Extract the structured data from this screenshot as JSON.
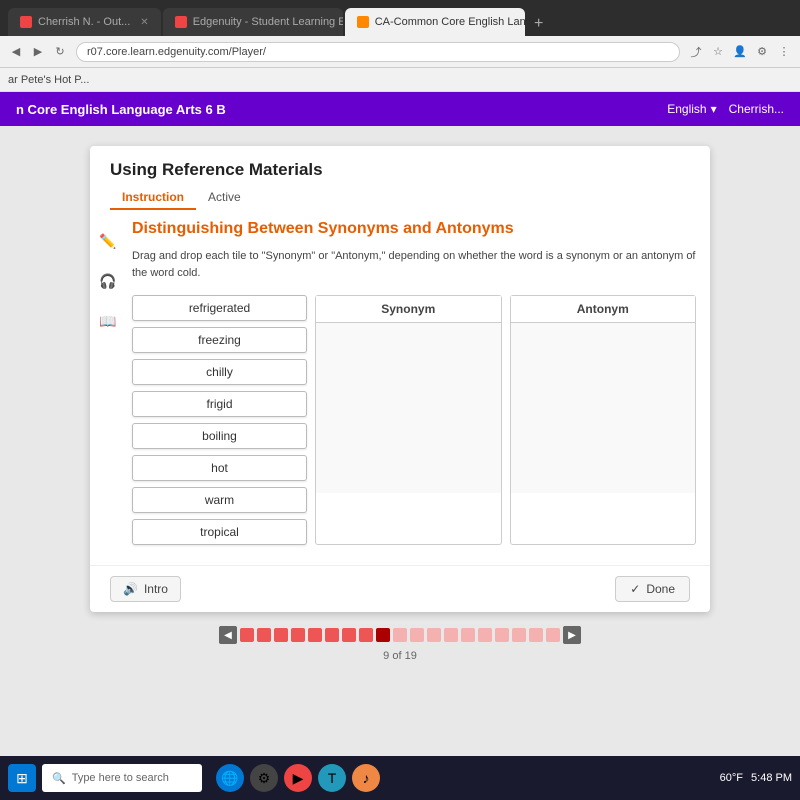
{
  "browser": {
    "tabs": [
      {
        "id": "tab1",
        "label": "Cherrish N. - Out...",
        "active": false,
        "favicon": "red"
      },
      {
        "id": "tab2",
        "label": "Edgenuity - Student Learning Ex...",
        "active": false,
        "favicon": "red"
      },
      {
        "id": "tab3",
        "label": "CA-Common Core English Langu...",
        "active": true,
        "favicon": "orange"
      }
    ],
    "address": "r07.core.learn.edgenuity.com/Player/",
    "bookmark": "ar Pete's Hot P..."
  },
  "site_header": {
    "title": "n Core English Language Arts 6 B",
    "lang_label": "English",
    "user_label": "Cherrish..."
  },
  "lesson": {
    "title": "Using Reference Materials",
    "tabs": [
      {
        "id": "instruction",
        "label": "Instruction",
        "active": true
      },
      {
        "id": "active",
        "label": "Active",
        "active": false
      }
    ],
    "activity_heading": "Distinguishing Between Synonyms and Antonyms",
    "instructions": "Drag and drop each tile to \"Synonym\" or \"Antonym,\" depending on whether the word is a synonym or an antonym of the word cold.",
    "words": [
      "refrigerated",
      "freezing",
      "chilly",
      "frigid",
      "boiling",
      "hot",
      "warm",
      "tropical"
    ],
    "drop_zones": [
      {
        "id": "synonym",
        "label": "Synonym"
      },
      {
        "id": "antonym",
        "label": "Antonym"
      }
    ],
    "buttons": {
      "intro": "Intro",
      "done": "Done"
    },
    "progress": {
      "current": 9,
      "total": 19,
      "label": "9 of 19"
    }
  },
  "taskbar": {
    "search_placeholder": "Type here to search",
    "time": "5:48 PM",
    "temp": "60°F"
  }
}
